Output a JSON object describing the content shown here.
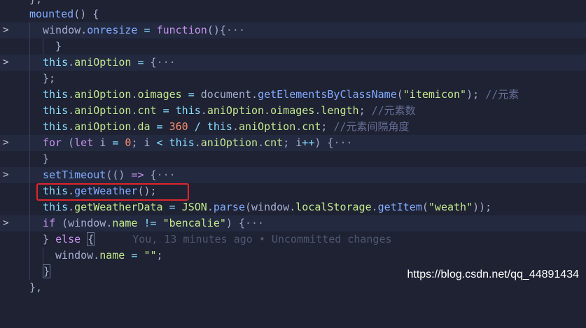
{
  "lines": [
    {
      "text": "},"
    },
    {
      "text": "mounted() {"
    },
    {
      "text": "window.onresize = function(){···"
    },
    {
      "text": "}"
    },
    {
      "text": "this.aniOption = {···"
    },
    {
      "text": "};"
    },
    {
      "text": "this.aniOption.oimages = document.getElementsByClassName(\"itemicon\"); //元素"
    },
    {
      "text": "this.aniOption.cnt = this.aniOption.oimages.length; //元素数"
    },
    {
      "text": "this.aniOption.da = 360 / this.aniOption.cnt; //元素间隔角度"
    },
    {
      "text": "for (let i = 0; i < this.aniOption.cnt; i++) {···"
    },
    {
      "text": "}"
    },
    {
      "text": "setTimeout(() => {···"
    },
    {
      "text": "this.getWeather();"
    },
    {
      "text": "this.getWeatherData = JSON.parse(window.localStorage.getItem(\"weath\"));"
    },
    {
      "text": "if (window.name != \"bencalie\") {···"
    },
    {
      "text": "} else {"
    },
    {
      "text": "window.name = \"\";"
    },
    {
      "text": "}"
    },
    {
      "text": "},"
    }
  ],
  "blame": "You, 13 minutes ago • Uncommitted changes",
  "watermark": "https://blog.csdn.net/qq_44891434",
  "fold_icon": "chevron-right-icon",
  "highlight_color": "#e0252a"
}
